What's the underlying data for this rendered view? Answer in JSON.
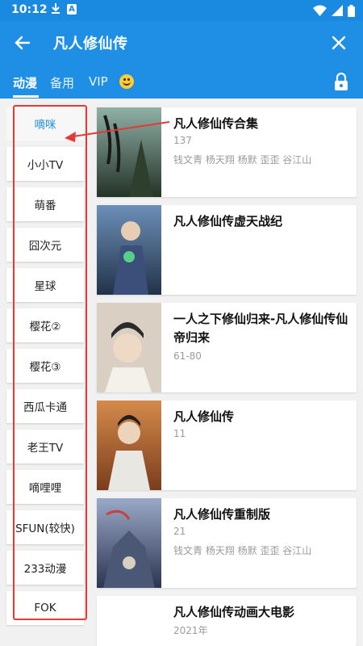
{
  "status": {
    "time": "10:12",
    "download_icon": "download-icon",
    "a_icon": "A"
  },
  "appbar": {
    "title": "凡人修仙传"
  },
  "tabs": [
    {
      "label": "动漫"
    },
    {
      "label": "备用"
    },
    {
      "label": "VIP"
    }
  ],
  "sources": [
    {
      "label": "嘀咪"
    },
    {
      "label": "小小TV"
    },
    {
      "label": "萌番"
    },
    {
      "label": "囧次元"
    },
    {
      "label": "星球"
    },
    {
      "label": "樱花②"
    },
    {
      "label": "樱花③"
    },
    {
      "label": "西瓜卡通"
    },
    {
      "label": "老王TV"
    },
    {
      "label": "嘀哩哩"
    },
    {
      "label": "SFUN(较快)"
    },
    {
      "label": "233动漫"
    },
    {
      "label": "FOK"
    }
  ],
  "results": [
    {
      "title": "凡人修仙传合集",
      "sub": "137",
      "cast": "钱文青 杨天翔 杨默 歪歪 谷江山",
      "poster": "#3a4b3e"
    },
    {
      "title": "凡人修仙传虚天战纪",
      "sub": "",
      "cast": "",
      "poster": "#3b5a7a"
    },
    {
      "title": "一人之下修仙归来-凡人修仙传仙帝归来",
      "sub": "61-80",
      "cast": "",
      "poster": "#c9b9a8"
    },
    {
      "title": "凡人修仙传",
      "sub": "11",
      "cast": "",
      "poster": "#c2703a"
    },
    {
      "title": "凡人修仙传重制版",
      "sub": "21",
      "cast": "钱文青 杨天翔 杨默 歪歪 谷江山",
      "poster": "#5a6a8a"
    },
    {
      "title": "凡人修仙传动画大电影",
      "sub": "2021年",
      "cast": "",
      "poster": "#ffffff"
    }
  ]
}
